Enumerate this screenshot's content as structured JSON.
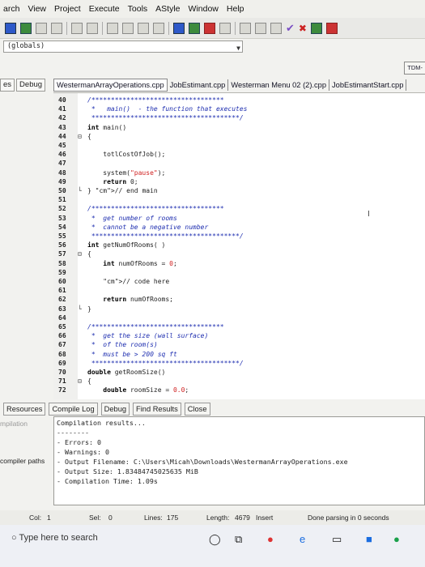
{
  "menu": [
    "arch",
    "View",
    "Project",
    "Execute",
    "Tools",
    "AStyle",
    "Window",
    "Help"
  ],
  "scope_selector": {
    "value": "(globals)"
  },
  "side_tab_right": "TDM-",
  "left_tabs": [
    "es",
    "Debug"
  ],
  "file_tabs": [
    {
      "label": "WestermanArrayOperations.cpp",
      "active": true
    },
    {
      "label": "JobEstimant.cpp",
      "active": false
    },
    {
      "label": "Westerman Menu 02 (2).cpp",
      "active": false
    },
    {
      "label": "JobEstimantStart.cpp",
      "active": false
    }
  ],
  "code_lines": [
    {
      "n": "40",
      "fold": "",
      "t": "/**********************************"
    },
    {
      "n": "41",
      "fold": "",
      "t": " *   main()  - the function that executes"
    },
    {
      "n": "42",
      "fold": "",
      "t": " **************************************/"
    },
    {
      "n": "43",
      "fold": "",
      "t": "int main()"
    },
    {
      "n": "44",
      "fold": "⊟",
      "t": "{"
    },
    {
      "n": "45",
      "fold": "",
      "t": ""
    },
    {
      "n": "46",
      "fold": "",
      "t": "    totlCostOfJob();"
    },
    {
      "n": "47",
      "fold": "",
      "t": ""
    },
    {
      "n": "48",
      "fold": "",
      "t": "    system(\"pause\");"
    },
    {
      "n": "49",
      "fold": "",
      "t": "    return 0;"
    },
    {
      "n": "50",
      "fold": "└",
      "t": "} // end main"
    },
    {
      "n": "51",
      "fold": "",
      "t": ""
    },
    {
      "n": "52",
      "fold": "",
      "t": "/**********************************"
    },
    {
      "n": "53",
      "fold": "",
      "t": " *  get number of rooms"
    },
    {
      "n": "54",
      "fold": "",
      "t": " *  cannot be a negative number"
    },
    {
      "n": "55",
      "fold": "",
      "t": " **************************************/"
    },
    {
      "n": "56",
      "fold": "",
      "t": "int getNumOfRooms( )"
    },
    {
      "n": "57",
      "fold": "⊟",
      "t": "{"
    },
    {
      "n": "58",
      "fold": "",
      "t": "    int numOfRooms = 0;"
    },
    {
      "n": "59",
      "fold": "",
      "t": ""
    },
    {
      "n": "60",
      "fold": "",
      "t": "    // code here"
    },
    {
      "n": "61",
      "fold": "",
      "t": ""
    },
    {
      "n": "62",
      "fold": "",
      "t": "    return numOfRooms;"
    },
    {
      "n": "63",
      "fold": "└",
      "t": "}"
    },
    {
      "n": "64",
      "fold": "",
      "t": ""
    },
    {
      "n": "65",
      "fold": "",
      "t": "/**********************************"
    },
    {
      "n": "66",
      "fold": "",
      "t": " *  get the size (wall surface)"
    },
    {
      "n": "67",
      "fold": "",
      "t": " *  of the room(s)"
    },
    {
      "n": "68",
      "fold": "",
      "t": " *  must be > 200 sq ft"
    },
    {
      "n": "69",
      "fold": "",
      "t": " **************************************/"
    },
    {
      "n": "70",
      "fold": "",
      "t": "double getRoomSize()"
    },
    {
      "n": "71",
      "fold": "⊟",
      "t": "{"
    },
    {
      "n": "72",
      "fold": "",
      "t": "    double roomSize = 0.0;"
    }
  ],
  "bottom_tabs": [
    "Resources",
    "Compile Log",
    "Debug",
    "Find Results",
    "Close"
  ],
  "left_panel": {
    "compilation": "mpilation",
    "compiler_paths": "compiler paths"
  },
  "compile_log": [
    "Compilation results...",
    "--------",
    "- Errors: 0",
    "- Warnings: 0",
    "- Output Filename: C:\\Users\\Micah\\Downloads\\WestermanArrayOperations.exe",
    "- Output Size: 1.83484745025635 MiB",
    "- Compilation Time: 1.09s"
  ],
  "status": {
    "col": "Col:",
    "col_val": "1",
    "sel": "Sel:",
    "sel_val": "0",
    "lines": "Lines:",
    "lines_val": "175",
    "length": "Length:",
    "length_val": "4679",
    "mode": "Insert",
    "parse": "Done parsing in 0 seconds"
  },
  "taskbar": {
    "search_placeholder": "Type here to search"
  },
  "colors": {
    "comment": "#1f2fb0",
    "number": "#d02020",
    "editor_bg": "#ffffff"
  }
}
